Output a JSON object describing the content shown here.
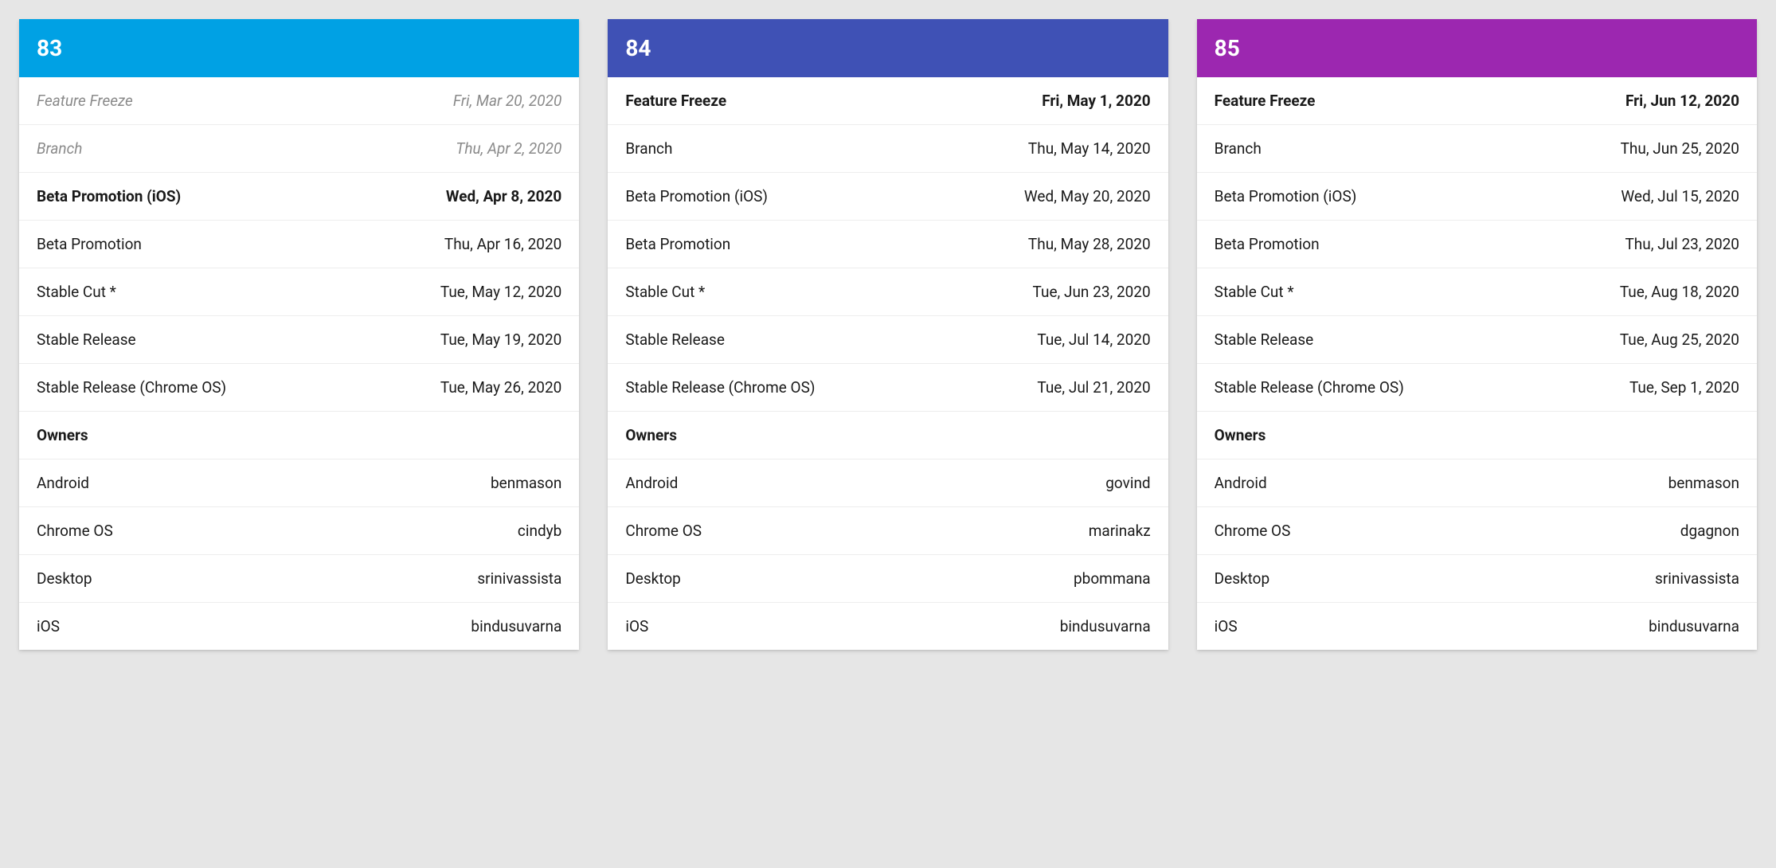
{
  "cards": [
    {
      "id": "release-83",
      "version": "83",
      "color": "#00a1e4",
      "milestones": [
        {
          "label": "Feature Freeze",
          "date": "Fri, Mar 20, 2020",
          "style": "past"
        },
        {
          "label": "Branch",
          "date": "Thu, Apr 2, 2020",
          "style": "past"
        },
        {
          "label": "Beta Promotion (iOS)",
          "date": "Wed, Apr 8, 2020",
          "style": "highlight"
        },
        {
          "label": "Beta Promotion",
          "date": "Thu, Apr 16, 2020",
          "style": ""
        },
        {
          "label": "Stable Cut *",
          "date": "Tue, May 12, 2020",
          "style": ""
        },
        {
          "label": "Stable Release",
          "date": "Tue, May 19, 2020",
          "style": ""
        },
        {
          "label": "Stable Release (Chrome OS)",
          "date": "Tue, May 26, 2020",
          "style": ""
        }
      ],
      "owners_title": "Owners",
      "owners": [
        {
          "platform": "Android",
          "owner": "benmason"
        },
        {
          "platform": "Chrome OS",
          "owner": "cindyb"
        },
        {
          "platform": "Desktop",
          "owner": "srinivassista"
        },
        {
          "platform": "iOS",
          "owner": "bindusuvarna"
        }
      ]
    },
    {
      "id": "release-84",
      "version": "84",
      "color": "#3f51b5",
      "milestones": [
        {
          "label": "Feature Freeze",
          "date": "Fri, May 1, 2020",
          "style": "highlight"
        },
        {
          "label": "Branch",
          "date": "Thu, May 14, 2020",
          "style": ""
        },
        {
          "label": "Beta Promotion (iOS)",
          "date": "Wed, May 20, 2020",
          "style": ""
        },
        {
          "label": "Beta Promotion",
          "date": "Thu, May 28, 2020",
          "style": ""
        },
        {
          "label": "Stable Cut *",
          "date": "Tue, Jun 23, 2020",
          "style": ""
        },
        {
          "label": "Stable Release",
          "date": "Tue, Jul 14, 2020",
          "style": ""
        },
        {
          "label": "Stable Release (Chrome OS)",
          "date": "Tue, Jul 21, 2020",
          "style": ""
        }
      ],
      "owners_title": "Owners",
      "owners": [
        {
          "platform": "Android",
          "owner": "govind"
        },
        {
          "platform": "Chrome OS",
          "owner": "marinakz"
        },
        {
          "platform": "Desktop",
          "owner": "pbommana"
        },
        {
          "platform": "iOS",
          "owner": "bindusuvarna"
        }
      ]
    },
    {
      "id": "release-85",
      "version": "85",
      "color": "#9c27b0",
      "milestones": [
        {
          "label": "Feature Freeze",
          "date": "Fri, Jun 12, 2020",
          "style": "highlight"
        },
        {
          "label": "Branch",
          "date": "Thu, Jun 25, 2020",
          "style": ""
        },
        {
          "label": "Beta Promotion (iOS)",
          "date": "Wed, Jul 15, 2020",
          "style": ""
        },
        {
          "label": "Beta Promotion",
          "date": "Thu, Jul 23, 2020",
          "style": ""
        },
        {
          "label": "Stable Cut *",
          "date": "Tue, Aug 18, 2020",
          "style": ""
        },
        {
          "label": "Stable Release",
          "date": "Tue, Aug 25, 2020",
          "style": ""
        },
        {
          "label": "Stable Release (Chrome OS)",
          "date": "Tue, Sep 1, 2020",
          "style": ""
        }
      ],
      "owners_title": "Owners",
      "owners": [
        {
          "platform": "Android",
          "owner": "benmason"
        },
        {
          "platform": "Chrome OS",
          "owner": "dgagnon"
        },
        {
          "platform": "Desktop",
          "owner": "srinivassista"
        },
        {
          "platform": "iOS",
          "owner": "bindusuvarna"
        }
      ]
    }
  ]
}
